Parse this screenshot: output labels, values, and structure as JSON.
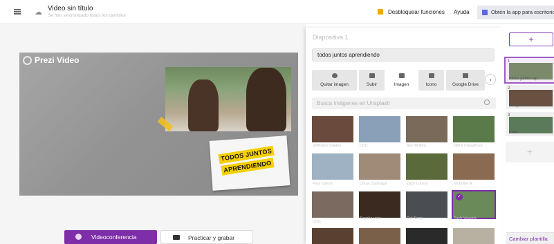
{
  "topbar": {
    "title": "Video sin título",
    "subtitle": "Se han sincronizado todos los cambios",
    "unlock_label": "Desbloquear funciones",
    "help_label": "Ayuda",
    "get_app_label": "Obtén la app para escritorio"
  },
  "canvas": {
    "brand": "Prezi Video",
    "sticky_line1": "TODOS JUNTOS",
    "sticky_line2": "APRENDIENDO"
  },
  "actions": {
    "videoconference_label": "Videoconferencia",
    "practice_label": "Practicar y grabar"
  },
  "panel": {
    "slide_header": "Diapositiva 1",
    "text_value": "todos juntos aprendiendo",
    "tools": [
      {
        "label": "Quitar imagen"
      },
      {
        "label": "Subir"
      },
      {
        "label": "Imagen"
      },
      {
        "label": "Icono"
      },
      {
        "label": "Google Drive"
      }
    ],
    "search_placeholder": "Busca imágenes en Unsplash",
    "images": [
      {
        "caption": "Jefferson Santos",
        "color": "#6a4a3c"
      },
      {
        "caption": "CDC",
        "color": "#8aa0b8"
      },
      {
        "caption": "Ben Mullins",
        "color": "#7a6a5a"
      },
      {
        "caption": "Nikhil Choudhary",
        "color": "#5a7a4a"
      },
      {
        "caption": "Paul Carroll",
        "color": "#9fb2c4"
      },
      {
        "caption": "Orkun Zadfolgar",
        "color": "#a08a78"
      },
      {
        "caption": "Zach Lucero",
        "color": "#5a6a3a"
      },
      {
        "caption": "Mobolhe R.",
        "color": "#8a6a50"
      },
      {
        "caption": "CDC",
        "color": "#7a6a60"
      },
      {
        "caption": "Sayaka yaku",
        "color": "#3a2a20"
      },
      {
        "caption": "Rat Sang",
        "color": "#4a4e52"
      },
      {
        "caption": "Zach Vessels",
        "color": "#6a8a5a"
      }
    ]
  },
  "slides": [
    {
      "num": "1",
      "title": "todos juntos ap...",
      "color": "#7a8a6a"
    },
    {
      "num": "2",
      "title": "compartiendo",
      "color": "#6a5040"
    },
    {
      "num": "3",
      "title": "exito",
      "color": "#5a7a5a"
    }
  ],
  "sidebar": {
    "add_label": "+",
    "add_slide_label": "+",
    "change_template_label": "Cambiar plantilla"
  }
}
